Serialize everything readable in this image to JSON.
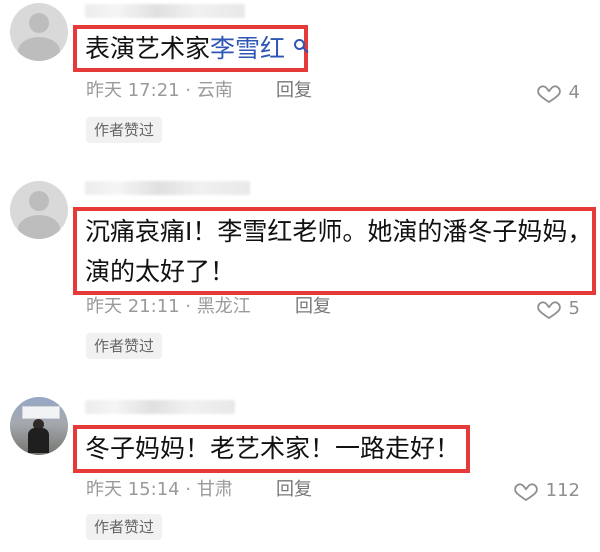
{
  "comments": [
    {
      "text_prefix": "表演艺术家",
      "mention": "李雪红",
      "time": "昨天 17:21",
      "location": "云南",
      "reply_label": "回复",
      "likes": "4",
      "badge": "作者赞过"
    },
    {
      "text": "沉痛哀痛Ⅰ！李雪红老师。她演的潘冬子妈妈，演的太好了！",
      "time": "昨天 21:11",
      "location": "黑龙江",
      "reply_label": "回复",
      "likes": "5",
      "badge": "作者赞过"
    },
    {
      "text": "冬子妈妈！老艺术家！一路走好！",
      "time": "昨天 15:14",
      "location": "甘肃",
      "reply_label": "回复",
      "likes": "112",
      "badge": "作者赞过"
    }
  ],
  "colors": {
    "highlight_border": "#e63a3a",
    "mention": "#2d56b5",
    "meta": "#9a9a9a",
    "badge_bg": "#f1f1f1"
  },
  "icons": {
    "default_avatar": "default-avatar-icon",
    "photo_avatar": "photo-avatar",
    "mention_search": "search-icon",
    "like": "heart-icon"
  }
}
